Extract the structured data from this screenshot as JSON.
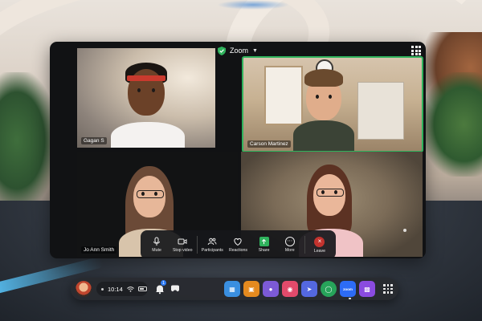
{
  "window": {
    "title": "Zoom",
    "icons": {
      "security": "shield-check-icon",
      "dropdown": "chevron-down-icon",
      "layout": "grid-view-icon"
    },
    "accent_active_speaker": "#2fb25c"
  },
  "participants": [
    {
      "name": "Gagan S"
    },
    {
      "name": "Carson Martinez",
      "active_speaker": true
    },
    {
      "name": "Jo Ann Smith"
    },
    {
      "name": ""
    }
  ],
  "controls": {
    "mute": {
      "label": "Mute",
      "icon": "microphone-icon"
    },
    "stop_video": {
      "label": "Stop video",
      "icon": "video-camera-icon"
    },
    "participants": {
      "label": "Participants",
      "icon": "people-icon"
    },
    "reactions": {
      "label": "Reactions",
      "icon": "heart-icon"
    },
    "share": {
      "label": "Share",
      "icon": "share-arrow-icon",
      "color": "#2fb25c"
    },
    "more": {
      "label": "More",
      "icon": "ellipsis-icon"
    },
    "leave": {
      "label": "Leave",
      "icon": "close-icon",
      "color": "#c3332e"
    }
  },
  "taskbar": {
    "time": "10:14",
    "notification_count": "1",
    "apps": [
      {
        "icon": "store-icon",
        "color": "#3a8fe0"
      },
      {
        "icon": "shopping-bag-icon",
        "color": "#e58a1f"
      },
      {
        "icon": "people-icon",
        "color": "#7c5ad6"
      },
      {
        "icon": "camera-icon",
        "color": "#e24a6b"
      },
      {
        "icon": "messenger-icon",
        "color": "#5468e0"
      },
      {
        "icon": "horizon-icon",
        "color": "#27a35a"
      },
      {
        "icon": "zoom-icon",
        "label": "zoom",
        "color": "#2d6cf5"
      },
      {
        "icon": "calendar-icon",
        "color": "#8a4be0"
      }
    ]
  }
}
